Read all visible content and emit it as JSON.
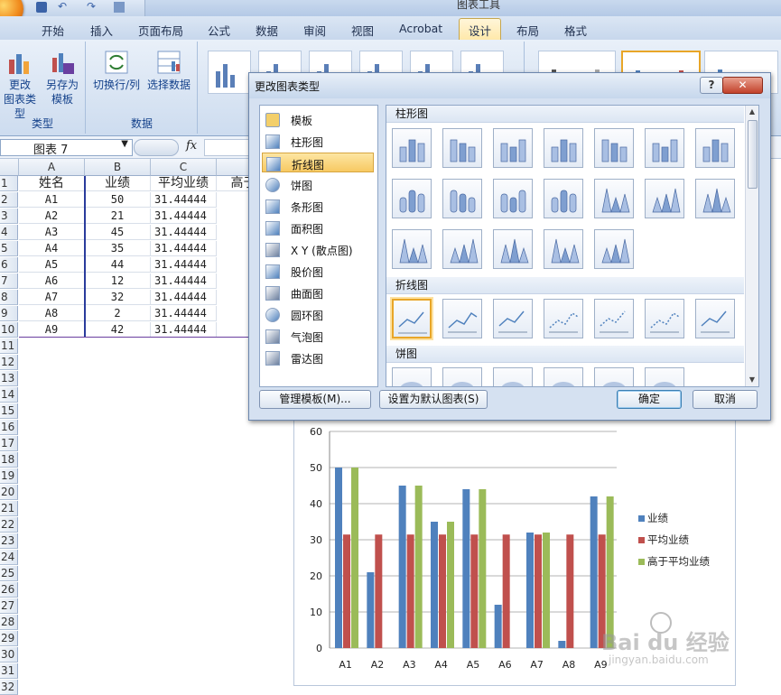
{
  "titlebar": {
    "context_tool": "图表工具"
  },
  "ribbon_tabs": [
    "开始",
    "插入",
    "页面布局",
    "公式",
    "数据",
    "审阅",
    "视图",
    "Acrobat",
    "设计",
    "布局",
    "格式"
  ],
  "active_tab": "设计",
  "ribbon": {
    "type_group": {
      "label": "类型",
      "change_type": [
        "更改",
        "图表类型"
      ],
      "save_template": [
        "另存为",
        "模板"
      ]
    },
    "data_group": {
      "label": "数据",
      "switch_row_col": "切换行/列",
      "select_data": "选择数据"
    }
  },
  "formula_bar": {
    "name_box": "图表 7",
    "fx": "fx"
  },
  "sheet": {
    "columns": [
      "A",
      "B",
      "C"
    ],
    "rows": [
      [
        "姓名",
        "业绩",
        "平均业绩",
        "高于"
      ],
      [
        "A1",
        "50",
        "31.44444"
      ],
      [
        "A2",
        "21",
        "31.44444"
      ],
      [
        "A3",
        "45",
        "31.44444"
      ],
      [
        "A4",
        "35",
        "31.44444"
      ],
      [
        "A5",
        "44",
        "31.44444"
      ],
      [
        "A6",
        "12",
        "31.44444"
      ],
      [
        "A7",
        "32",
        "31.44444"
      ],
      [
        "A8",
        "2",
        "31.44444"
      ],
      [
        "A9",
        "42",
        "31.44444"
      ]
    ],
    "row_numbers": [
      "1",
      "2",
      "3",
      "4",
      "5",
      "6",
      "7",
      "8",
      "9",
      "10",
      "11",
      "12",
      "13",
      "14",
      "15",
      "16",
      "17",
      "18",
      "19",
      "20",
      "21",
      "22",
      "23",
      "24",
      "25",
      "26",
      "27",
      "28",
      "29",
      "30",
      "31",
      "32"
    ]
  },
  "dialog": {
    "title": "更改图表类型",
    "help": "?",
    "close": "✕",
    "types": [
      {
        "label": "模板",
        "icon": "folder-icon"
      },
      {
        "label": "柱形图",
        "icon": "column-chart-icon"
      },
      {
        "label": "折线图",
        "icon": "line-chart-icon"
      },
      {
        "label": "饼图",
        "icon": "pie-chart-icon"
      },
      {
        "label": "条形图",
        "icon": "bar-chart-icon"
      },
      {
        "label": "面积图",
        "icon": "area-chart-icon"
      },
      {
        "label": "X Y (散点图)",
        "icon": "scatter-chart-icon"
      },
      {
        "label": "股价图",
        "icon": "stock-chart-icon"
      },
      {
        "label": "曲面图",
        "icon": "surface-chart-icon"
      },
      {
        "label": "圆环图",
        "icon": "doughnut-chart-icon"
      },
      {
        "label": "气泡图",
        "icon": "bubble-chart-icon"
      },
      {
        "label": "雷达图",
        "icon": "radar-chart-icon"
      }
    ],
    "selected_type": "折线图",
    "sections": {
      "column": "柱形图",
      "line": "折线图",
      "pie": "饼图"
    },
    "buttons": {
      "manage_templates": "管理模板(M)...",
      "set_default": "设置为默认图表(S)",
      "ok": "确定",
      "cancel": "取消"
    }
  },
  "colors": {
    "series1": "#4f81bd",
    "series2": "#c0504d",
    "series3": "#9bbb59",
    "accent": "#e8a628"
  },
  "chart_data": {
    "type": "bar",
    "categories": [
      "A1",
      "A2",
      "A3",
      "A4",
      "A5",
      "A6",
      "A7",
      "A8",
      "A9"
    ],
    "series": [
      {
        "name": "业绩",
        "values": [
          50,
          21,
          45,
          35,
          44,
          12,
          32,
          2,
          42
        ]
      },
      {
        "name": "平均业绩",
        "values": [
          31.44444,
          31.44444,
          31.44444,
          31.44444,
          31.44444,
          31.44444,
          31.44444,
          31.44444,
          31.44444
        ]
      },
      {
        "name": "高于平均业绩",
        "values": [
          50,
          null,
          45,
          35,
          44,
          null,
          32,
          null,
          42
        ]
      }
    ],
    "yticks": [
      "0",
      "10",
      "20",
      "30",
      "40",
      "50",
      "60"
    ],
    "ylim": [
      0,
      60
    ],
    "grid": true,
    "legend": "right"
  },
  "watermark": {
    "brand": "Bai du 经验",
    "url": "jingyan.baidu.com"
  }
}
